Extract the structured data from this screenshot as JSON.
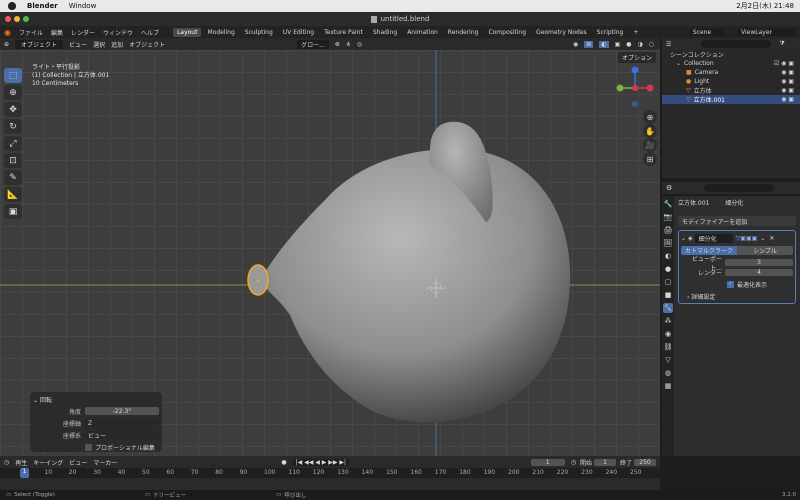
{
  "macbar": {
    "apple": "",
    "app": "Blender",
    "menu": "Window",
    "datetime": "2月2日(木) 21:48"
  },
  "window": {
    "title": "untitled.blend"
  },
  "menus": [
    "ファイル",
    "編集",
    "レンダー",
    "ウィンドウ",
    "ヘルプ"
  ],
  "workspaces": [
    "Layout",
    "Modeling",
    "Sculpting",
    "UV Editing",
    "Texture Paint",
    "Shading",
    "Animation",
    "Rendering",
    "Compositing",
    "Geometry Nodes",
    "Scripting"
  ],
  "active_workspace": "Layout",
  "topright": {
    "scene": "Scene",
    "viewlayer": "ViewLayer"
  },
  "viewport_header": {
    "mode": "オブジェクト",
    "items": [
      "ビュー",
      "選択",
      "追加",
      "オブジェクト"
    ],
    "transform": "グロー...",
    "options": "オプション"
  },
  "viewport_info": {
    "line1": "ライト・平行投影",
    "line2": "(1) Collection | 立方体.001",
    "line3": "10 Centimeters"
  },
  "operator_panel": {
    "title": "回転",
    "angle_label": "角度",
    "angle_value": "-22.3°",
    "axis_label": "座標軸",
    "axis_value": "Z",
    "orient_label": "座標系",
    "orient_value": "ビュー",
    "proportional": "プロポーショナル編集"
  },
  "outliner": {
    "header": "シーンコレクション",
    "collection": "Collection",
    "items": [
      "Camera",
      "Light",
      "立方体",
      "立方体.001"
    ]
  },
  "properties": {
    "object_name": "立方体.001",
    "modifier_label": "細分化",
    "add_modifier": "モディファイアーを追加",
    "method_a": "カトマルクラーク",
    "method_b": "シンプル",
    "viewport_label": "ビューポート...",
    "viewport_value": "3",
    "render_label": "レンダー",
    "render_value": "4",
    "optimal": "最適化表示",
    "advanced": "詳細設定"
  },
  "timeline": {
    "menus": [
      "再生",
      "キーイング",
      "ビュー",
      "マーカー"
    ],
    "current": "1",
    "start_label": "開始",
    "start": "1",
    "end_label": "終了",
    "end": "250",
    "ticks": [
      "0",
      "10",
      "20",
      "30",
      "40",
      "50",
      "60",
      "70",
      "80",
      "90",
      "100",
      "110",
      "120",
      "130",
      "140",
      "150",
      "160",
      "170",
      "180",
      "190",
      "200",
      "210",
      "220",
      "230",
      "240",
      "250"
    ]
  },
  "status": {
    "select": "Select (Toggle)",
    "pan": "ドリービュー",
    "menu": "呼び出し",
    "version": "3.2.0"
  },
  "colors": {
    "accent": "#4b6ea8",
    "selected": "#334d80",
    "orange": "#f5a623"
  }
}
